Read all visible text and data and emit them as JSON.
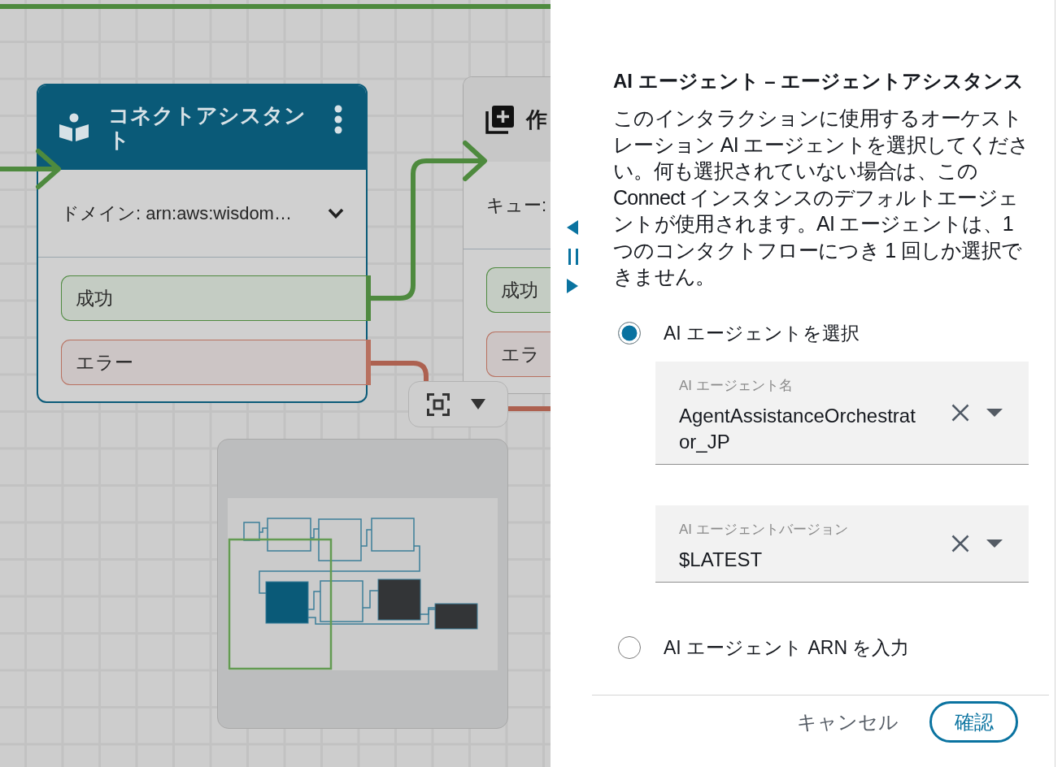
{
  "canvas": {
    "nodes": [
      {
        "kind": "assistant",
        "selected": true,
        "clipped": false,
        "title": "コネクトアシスタント",
        "parameter": "ドメイン: arn:aws:wisdom…",
        "branches": [
          {
            "kind": "success",
            "label": "成功"
          },
          {
            "kind": "error",
            "label": "エラー"
          }
        ]
      },
      {
        "kind": "create",
        "selected": false,
        "clipped": true,
        "title": "作",
        "parameter": "キュー:",
        "branches": [
          {
            "kind": "success",
            "label": "成功"
          },
          {
            "kind": "error",
            "label": "エラ"
          }
        ]
      }
    ]
  },
  "panel": {
    "title": "AI エージェント – エージェントアシスタンス",
    "description": "このインタラクションに使用するオーケストレーション AI エージェントを選択してください。何も選択されていない場合は、この Connect インスタンスのデフォルトエージェントが使用されます。AI エージェントは、1 つのコンタクトフローにつき 1 回しか選択できません。",
    "options": [
      {
        "label": "AI エージェントを選択",
        "selected": true,
        "fields": [
          {
            "label": "AI エージェント名",
            "value": "AgentAssistanceOrchestrator_JP"
          },
          {
            "label": "AI エージェントバージョン",
            "value": "$LATEST"
          }
        ]
      },
      {
        "label": "AI エージェント ARN を入力",
        "selected": false
      }
    ],
    "buttons": [
      {
        "kind": "secondary",
        "label": "キャンセル"
      },
      {
        "kind": "primary",
        "label": "確認"
      }
    ]
  }
}
